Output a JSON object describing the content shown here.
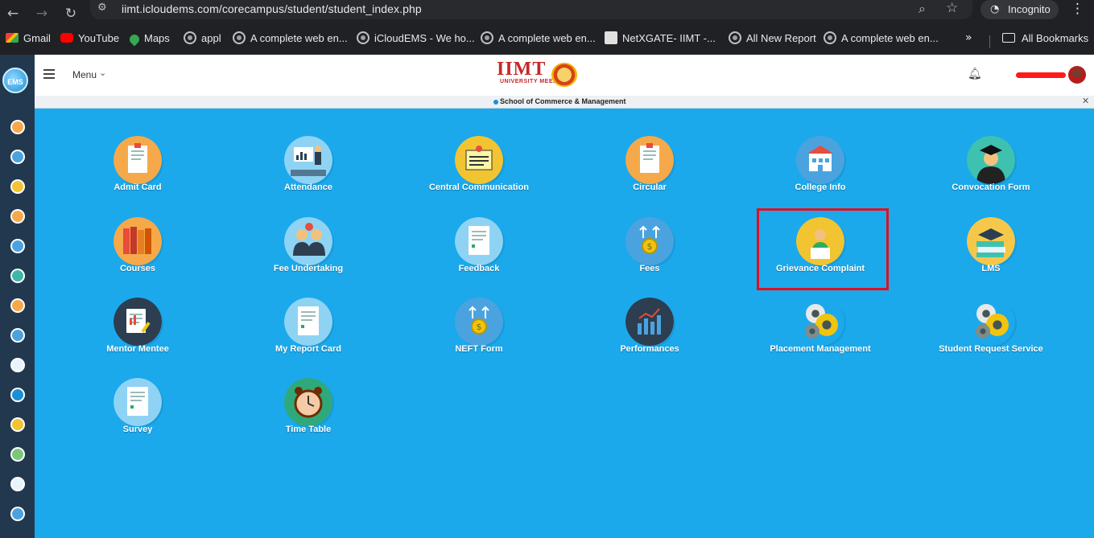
{
  "browser": {
    "url": "iimt.icloudems.com/corecampus/student/student_index.php",
    "incognito_label": "Incognito",
    "bookmarks": [
      {
        "label": "Gmail",
        "icon": "gmail-icon"
      },
      {
        "label": "YouTube",
        "icon": "youtube-icon"
      },
      {
        "label": "Maps",
        "icon": "maps-icon"
      },
      {
        "label": "appl",
        "icon": "globe-icon"
      },
      {
        "label": "A complete web en...",
        "icon": "globe-icon"
      },
      {
        "label": "iCloudEMS - We ho...",
        "icon": "globe-icon"
      },
      {
        "label": "A complete web en...",
        "icon": "globe-icon"
      },
      {
        "label": "NetXGATE- IIMT -...",
        "icon": "netxgate-icon"
      },
      {
        "label": "All New Report",
        "icon": "globe-icon"
      },
      {
        "label": "A complete web en...",
        "icon": "globe-icon"
      }
    ],
    "all_bookmarks_label": "All Bookmarks"
  },
  "sidebar": {
    "logo_text": "EMS",
    "icon_colors": [
      "#f6a94a",
      "#4aa3df",
      "#f3c431",
      "#f6a94a",
      "#4aa3df",
      "#3fb6a8",
      "#f6a94a",
      "#4aa3df",
      "#e8f4fb",
      "#1b8fd6",
      "#f3c431",
      "#7bc67b",
      "#e8f4fb",
      "#4aa3df"
    ]
  },
  "header": {
    "menu_label": "Menu",
    "logo_text": "IIMT",
    "logo_sub": "UNIVERSITY MEERUT"
  },
  "school": {
    "name": "School of Commerce & Management"
  },
  "tiles": [
    {
      "label": "Admit Card",
      "name": "admit-card",
      "color": "#f6a94a"
    },
    {
      "label": "Attendance",
      "name": "attendance",
      "color": "#8fd3f4"
    },
    {
      "label": "Central Communication",
      "name": "central-communication",
      "color": "#f3c431"
    },
    {
      "label": "Circular",
      "name": "circular",
      "color": "#f6a94a"
    },
    {
      "label": "College Info",
      "name": "college-info",
      "color": "#4aa3df"
    },
    {
      "label": "Convocation Form",
      "name": "convocation-form",
      "color": "#3fc1b0"
    },
    {
      "label": "Courses",
      "name": "courses",
      "color": "#f6a94a"
    },
    {
      "label": "Fee Undertaking",
      "name": "fee-undertaking",
      "color": "#8fd3f4"
    },
    {
      "label": "Feedback",
      "name": "feedback",
      "color": "#8fd3f4"
    },
    {
      "label": "Fees",
      "name": "fees",
      "color": "#4aa3df"
    },
    {
      "label": "Grievance Complaint",
      "name": "grievance-complaint",
      "color": "#f3c431"
    },
    {
      "label": "LMS",
      "name": "lms",
      "color": "#f6c84a"
    },
    {
      "label": "Mentor Mentee",
      "name": "mentor-mentee",
      "color": "#2c3e50"
    },
    {
      "label": "My Report Card",
      "name": "my-report-card",
      "color": "#8fd3f4"
    },
    {
      "label": "NEFT Form",
      "name": "neft-form",
      "color": "#4aa3df"
    },
    {
      "label": "Performances",
      "name": "performances",
      "color": "#2c3e50"
    },
    {
      "label": "Placement Management",
      "name": "placement-management",
      "color": "#1ba9ec"
    },
    {
      "label": "Student Request Service",
      "name": "student-request-service",
      "color": "#1ba9ec"
    },
    {
      "label": "Survey",
      "name": "survey",
      "color": "#8fd3f4"
    },
    {
      "label": "Time Table",
      "name": "time-table",
      "color": "#2fa97a"
    }
  ]
}
